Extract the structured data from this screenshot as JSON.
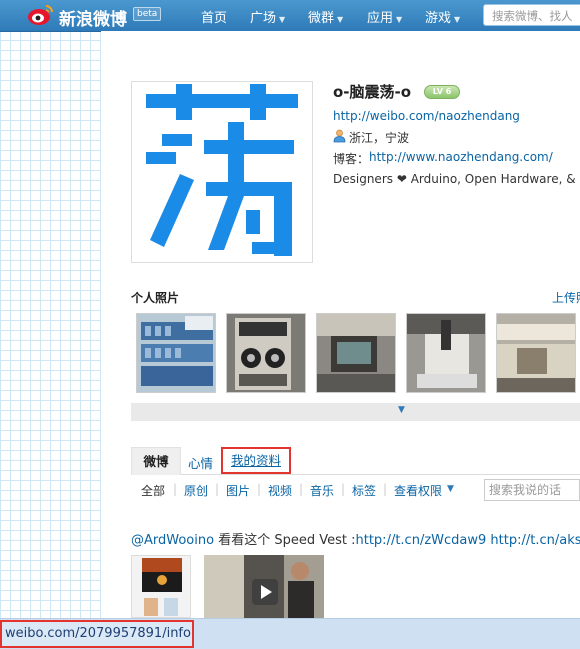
{
  "topbar": {
    "logo_text": "新浪微博",
    "beta_label": "beta",
    "nav": [
      {
        "label": "首页",
        "dropdown": false
      },
      {
        "label": "广场",
        "dropdown": true
      },
      {
        "label": "微群",
        "dropdown": true
      },
      {
        "label": "应用",
        "dropdown": true
      },
      {
        "label": "游戏",
        "dropdown": true
      }
    ],
    "search_placeholder": "搜索微博、找人"
  },
  "profile": {
    "name": "o-脑震荡-o",
    "level": "LV 6",
    "url": "http://weibo.com/naozhendang",
    "location": "浙江，宁波",
    "blog_label": "博客：",
    "blog_url": "http://www.naozhendang.com/",
    "bio_prefix": "Designers",
    "bio_suffix": "Arduino, Open Hardware, & Ope",
    "avatar_glyph": "荡",
    "avatar_color": "#1a8be6"
  },
  "photos": {
    "title": "个人照片",
    "upload_link": "上传照"
  },
  "tabs": {
    "weibo": "微博",
    "mood": "心情",
    "my_profile": "我的资料"
  },
  "filters": {
    "all": "全部",
    "original": "原创",
    "image": "图片",
    "video": "视频",
    "music": "音乐",
    "tags": "标签",
    "permission": "查看权限",
    "search_placeholder": "搜索我说的话"
  },
  "post": {
    "mention": "@ArdWooino",
    "text": " 看看这个 Speed Vest :",
    "link1": "http://t.cn/zWcdaw9",
    "link2": "http://t.cn/aksP"
  },
  "statusbar": {
    "url": "weibo.com/2079957891/info"
  },
  "colors": {
    "topbar": "#3a88c4",
    "link": "#0a64a4",
    "highlight": "#e3342f"
  }
}
